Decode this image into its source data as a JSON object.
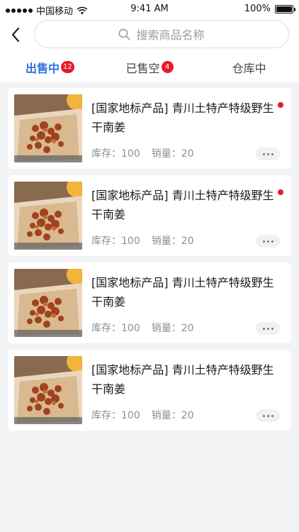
{
  "status_bar": {
    "carrier": "中国移动",
    "time": "9:41 AM",
    "battery": "100%"
  },
  "search": {
    "placeholder": "搜索商品名称"
  },
  "tabs": [
    {
      "label": "出售中",
      "badge": "12",
      "active": true
    },
    {
      "label": "已售空",
      "badge": "4",
      "active": false
    },
    {
      "label": "仓库中",
      "badge": "",
      "active": false
    }
  ],
  "products": [
    {
      "title": "[国家地标产品] 青川土特产特级野生干南姜",
      "stock_label": "库存：100",
      "sales_label": "销量：20",
      "unread": true
    },
    {
      "title": "[国家地标产品] 青川土特产特级野生干南姜",
      "stock_label": "库存：100",
      "sales_label": "销量：20",
      "unread": true
    },
    {
      "title": "[国家地标产品] 青川土特产特级野生干南姜",
      "stock_label": "库存：100",
      "sales_label": "销量：20",
      "unread": false
    },
    {
      "title": "[国家地标产品] 青川土特产特级野生干南姜",
      "stock_label": "库存：100",
      "sales_label": "销量：20",
      "unread": false
    }
  ],
  "colors": {
    "accent": "#2f6fe0",
    "badge": "#e8192c",
    "background": "#f2f3f5"
  }
}
